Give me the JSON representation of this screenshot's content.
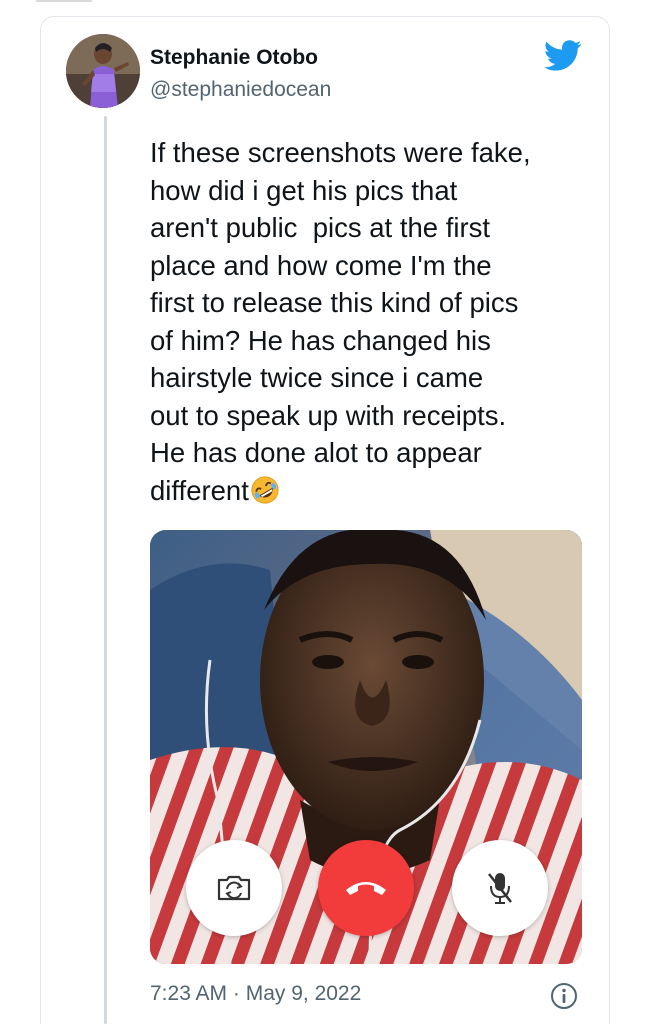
{
  "tweet": {
    "author": {
      "display_name": "Stephanie Otobo",
      "handle": "@stephaniedocean"
    },
    "text": "If these screenshots were fake,\nhow did i get his pics that\naren't public  pics at the first\nplace and how come I'm the\nfirst to release this kind of pics\nof him? He has changed his\nhairstyle twice since i came\nout to speak up with receipts.\nHe has done alot to appear\ndifferent",
    "emoji": "rolling-on-floor-laughing",
    "timestamp": "7:23 AM · May 9, 2022"
  },
  "video_call": {
    "controls": [
      "camera-switch",
      "end-call",
      "mute-microphone"
    ],
    "end_call_color": "#f23b3b"
  },
  "colors": {
    "twitter_blue": "#1d9bf0",
    "text_primary": "#0f1419",
    "text_secondary": "#536471"
  }
}
